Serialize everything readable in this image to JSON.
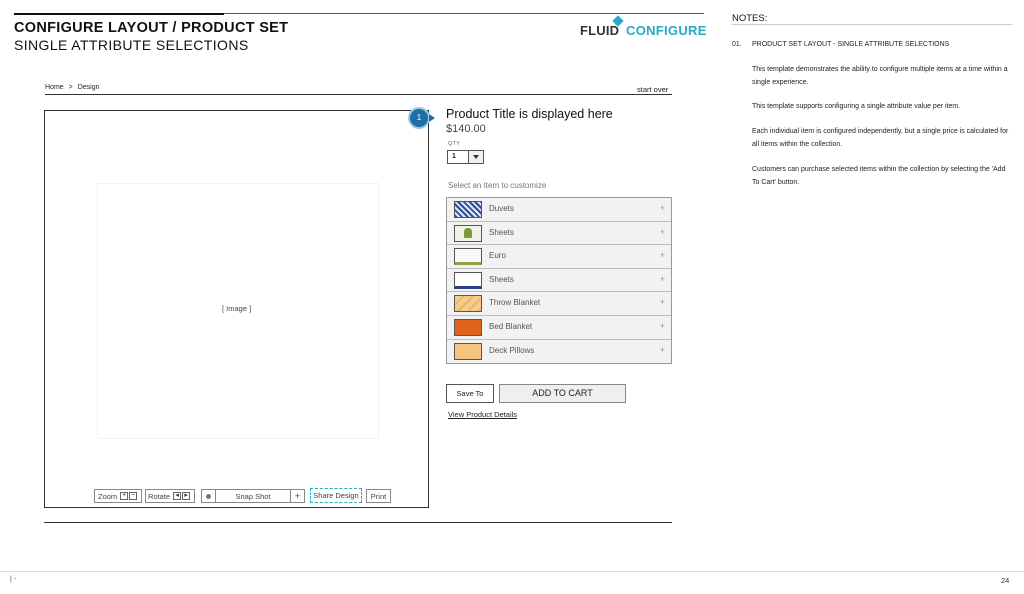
{
  "header": {
    "title": "CONFIGURE LAYOUT / PRODUCT SET",
    "subtitle": "SINGLE ATTRIBUTE SELECTIONS",
    "logo_part1": "FLUID",
    "logo_part2": "CONFIGURE"
  },
  "notes": {
    "title": "NOTES:",
    "number": "01.",
    "heading": "PRODUCT SET LAYOUT - SINGLE ATTRIBUTE SELECTIONS",
    "paragraphs": [
      "This template demonstrates the ability to configure multiple items at a time within a single experience.",
      "This template supports configuring a single attribute value per item.",
      "Each individual item is configured independently, but a single price is calculated for all items within the collection.",
      "Customers can purchase selected items within the collection by selecting the 'Add To Cart' button."
    ]
  },
  "breadcrumb": {
    "home": "Home",
    "separator": ">",
    "current": "Design",
    "start_over": "start over"
  },
  "image_viewer": {
    "placeholder": "[ Image ]",
    "zoom_label": "Zoom",
    "rotate_label": "Rotate",
    "snapshot_label": "Snap Shot",
    "snapshot_plus": "+",
    "share_label": "Share Design",
    "print_label": "Print"
  },
  "callout_number": "1",
  "product": {
    "title": "Product Title is displayed here",
    "price": "$140.00",
    "qty_label": "QTY",
    "qty_value": "1",
    "select_prompt": "Select an Item to customize",
    "items": [
      {
        "label": "Duvets",
        "thumb": "duvets"
      },
      {
        "label": "Sheets",
        "thumb": "sheets1"
      },
      {
        "label": "Euro",
        "thumb": "euro"
      },
      {
        "label": "Sheets",
        "thumb": "sheets2"
      },
      {
        "label": "Throw Blanket",
        "thumb": "throw"
      },
      {
        "label": "Bed Blanket",
        "thumb": "bed"
      },
      {
        "label": "Deck Pillows",
        "thumb": "deck"
      }
    ],
    "item_plus": "+",
    "save_to": "Save To",
    "add_to_cart": "ADD TO CART",
    "view_details": "View Product Details"
  },
  "footer": {
    "left": "|  -",
    "page_number": "24"
  },
  "colors": {
    "accent": "#29a9c9",
    "callout": "#1e6fa6"
  }
}
